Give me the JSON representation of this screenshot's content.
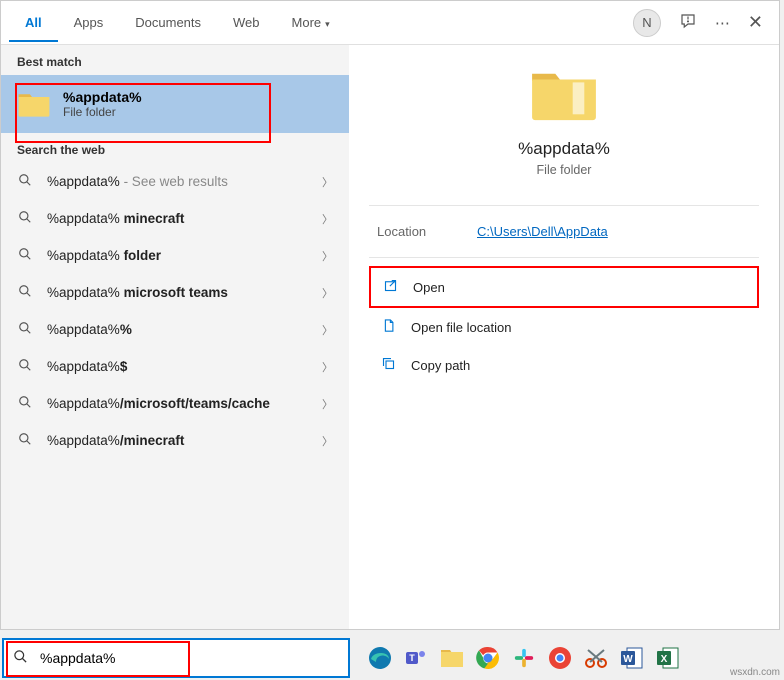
{
  "header": {
    "tabs": [
      "All",
      "Apps",
      "Documents",
      "Web",
      "More"
    ],
    "active_tab": 0,
    "avatar_letter": "N"
  },
  "left": {
    "best_match_label": "Best match",
    "best_match": {
      "title": "%appdata%",
      "subtitle": "File folder"
    },
    "search_web_label": "Search the web",
    "web_results": [
      {
        "prefix": "%appdata%",
        "bold": "",
        "suffix_light": " - See web results"
      },
      {
        "prefix": "%appdata% ",
        "bold": "minecraft",
        "suffix_light": ""
      },
      {
        "prefix": "%appdata% ",
        "bold": "folder",
        "suffix_light": ""
      },
      {
        "prefix": "%appdata% ",
        "bold": "microsoft teams",
        "suffix_light": ""
      },
      {
        "prefix": "%appdata%",
        "bold": "%",
        "suffix_light": ""
      },
      {
        "prefix": "%appdata%",
        "bold": "$",
        "suffix_light": ""
      },
      {
        "prefix": "%appdata%",
        "bold": "/microsoft/teams/cache",
        "suffix_light": ""
      },
      {
        "prefix": "%appdata%",
        "bold": "/minecraft",
        "suffix_light": ""
      }
    ]
  },
  "right": {
    "title": "%appdata%",
    "subtitle": "File folder",
    "location_label": "Location",
    "location_value": "C:\\Users\\Dell\\AppData",
    "actions": [
      {
        "icon": "open",
        "label": "Open"
      },
      {
        "icon": "file-location",
        "label": "Open file location"
      },
      {
        "icon": "copy",
        "label": "Copy path"
      }
    ]
  },
  "search": {
    "value": "%appdata%"
  },
  "watermark": "wsxdn.com"
}
